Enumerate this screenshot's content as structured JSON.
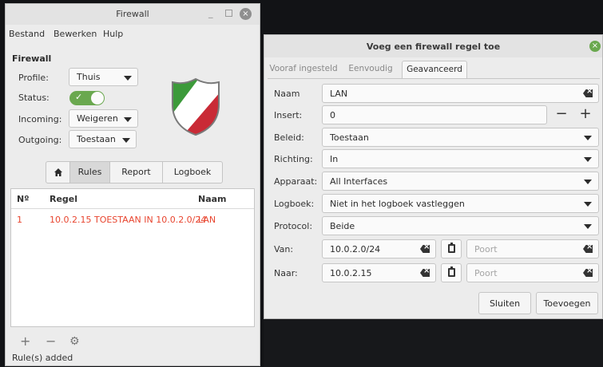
{
  "main": {
    "title": "Firewall",
    "menu": [
      "Bestand",
      "Bewerken",
      "Hulp"
    ],
    "section_title": "Firewall",
    "profile_label": "Profile:",
    "profile_value": "Thuis",
    "status_label": "Status:",
    "status_on": true,
    "incoming_label": "Incoming:",
    "incoming_value": "Weigeren",
    "outgoing_label": "Outgoing:",
    "outgoing_value": "Toestaan",
    "tabs": [
      "Rules",
      "Report",
      "Logboek"
    ],
    "columns": [
      "Nº",
      "Regel",
      "Naam"
    ],
    "rows": [
      {
        "no": "1",
        "rule": "10.0.2.15 TOESTAAN IN 10.0.2.0/24",
        "name": "LAN"
      }
    ],
    "status_text": "Rule(s) added",
    "accent_rule_color": "#e8452f",
    "toggle_color": "#6aa84f"
  },
  "dialog": {
    "title": "Voeg een firewall regel toe",
    "tabs": [
      "Vooraf ingesteld",
      "Eenvoudig",
      "Geavanceerd"
    ],
    "active_tab": "Geavanceerd",
    "name_label": "Naam",
    "name_value": "LAN",
    "insert_label": "Insert:",
    "insert_value": "0",
    "policy_label": "Beleid:",
    "policy_value": "Toestaan",
    "direction_label": "Richting:",
    "direction_value": "In",
    "device_label": "Apparaat:",
    "device_value": "All Interfaces",
    "log_label": "Logboek:",
    "log_value": "Niet in het logboek vastleggen",
    "protocol_label": "Protocol:",
    "protocol_value": "Beide",
    "from_label": "Van:",
    "from_value": "10.0.2.0/24",
    "from_port_placeholder": "Poort",
    "to_label": "Naar:",
    "to_value": "10.0.2.15",
    "to_port_placeholder": "Poort",
    "close_button": "Sluiten",
    "add_button": "Toevoegen"
  }
}
